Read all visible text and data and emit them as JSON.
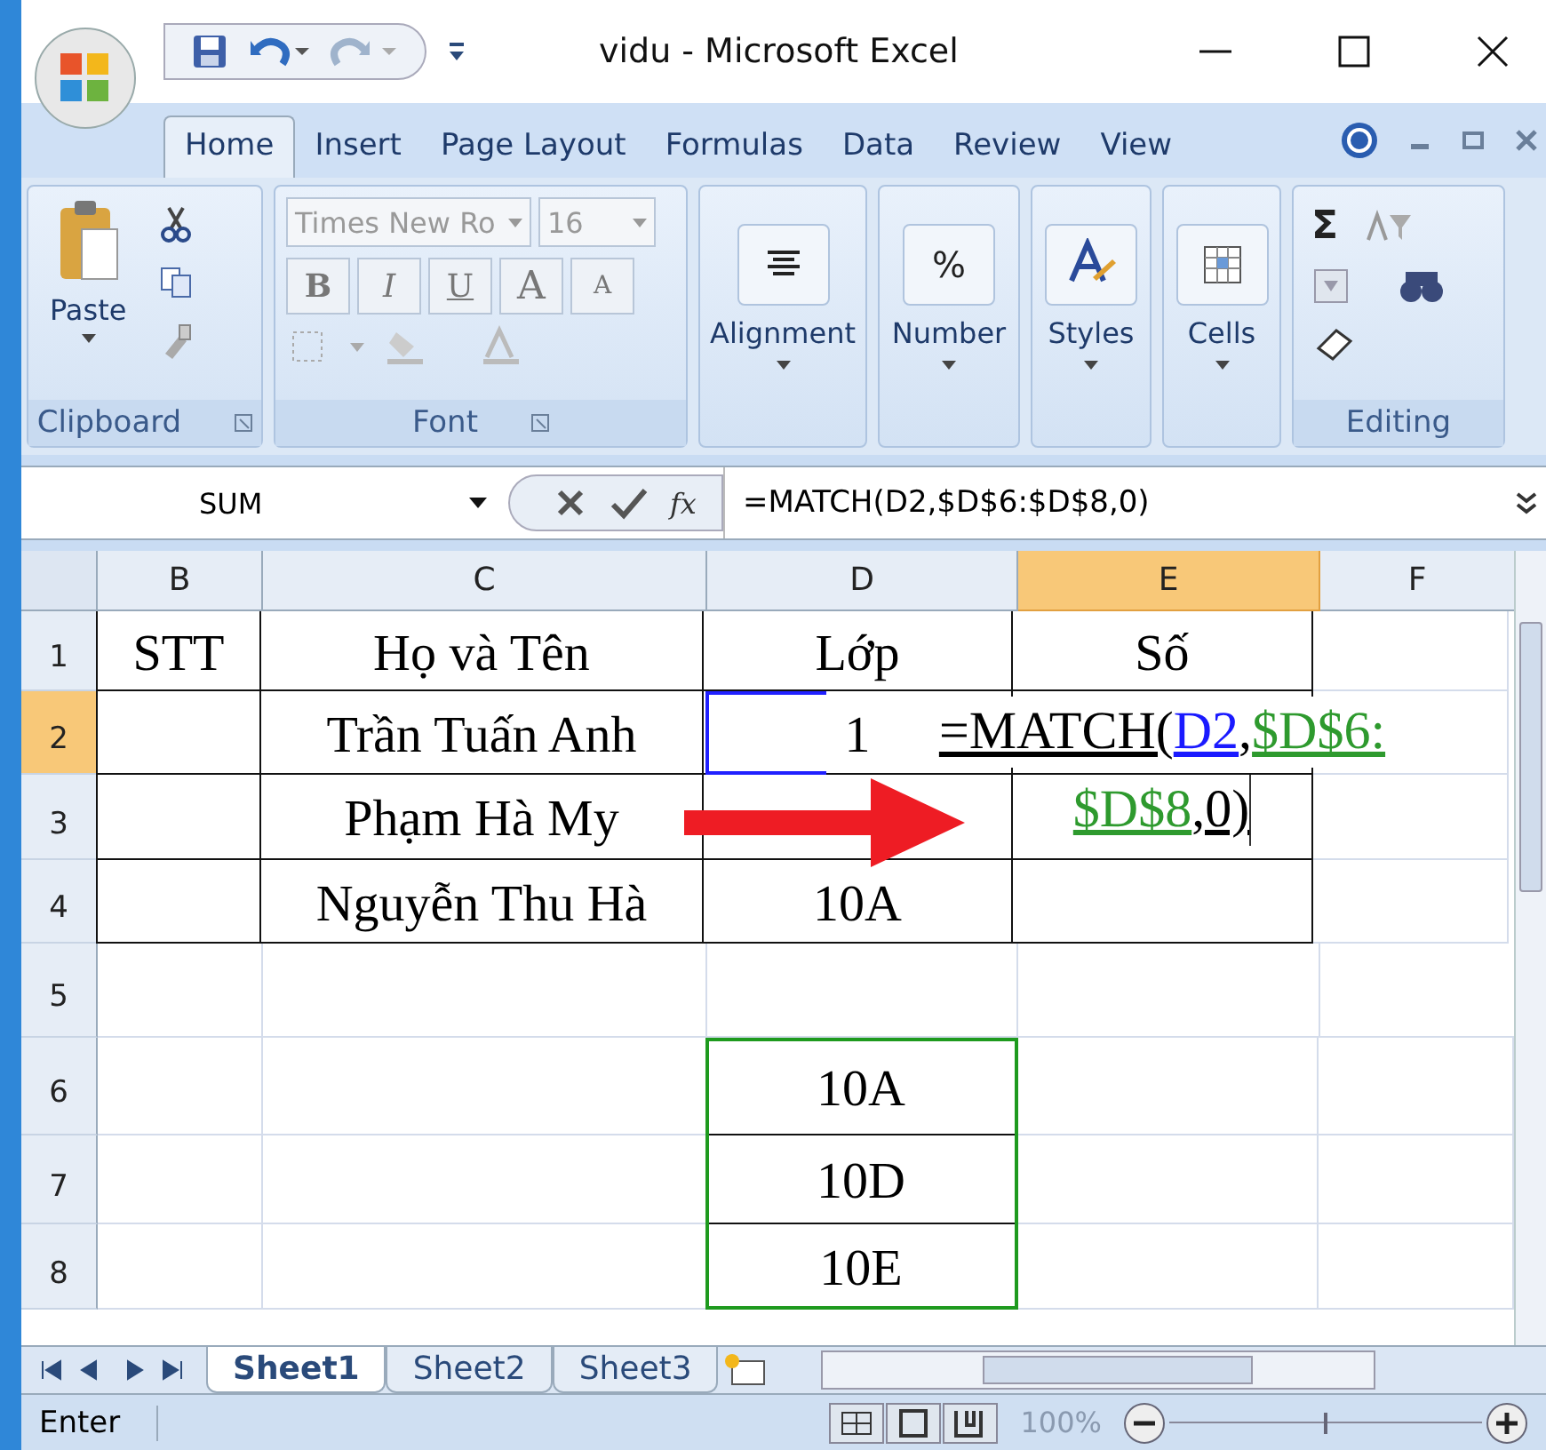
{
  "window": {
    "title": "vidu - Microsoft Excel"
  },
  "ribbon_tabs": [
    {
      "label": "Home",
      "selected": true
    },
    {
      "label": "Insert",
      "selected": false
    },
    {
      "label": "Page Layout",
      "selected": false
    },
    {
      "label": "Formulas",
      "selected": false
    },
    {
      "label": "Data",
      "selected": false
    },
    {
      "label": "Review",
      "selected": false
    },
    {
      "label": "View",
      "selected": false
    }
  ],
  "ribbon": {
    "clipboard": {
      "label": "Clipboard",
      "paste": "Paste"
    },
    "font": {
      "label": "Font",
      "font_name": "Times New Ro",
      "font_size": "16",
      "bold": "B",
      "italic": "I",
      "underline": "U",
      "grow": "A",
      "shrink": "A"
    },
    "groups": [
      {
        "label": "Alignment",
        "kind": "align"
      },
      {
        "label": "Number",
        "kind": "number",
        "glyph": "%"
      },
      {
        "label": "Styles",
        "kind": "styles"
      },
      {
        "label": "Cells",
        "kind": "cells"
      }
    ],
    "editing": {
      "label": "Editing",
      "autosum": "Σ"
    }
  },
  "formula_bar": {
    "name_box": "SUM",
    "function_button": "fx",
    "formula": "=MATCH(D2,$D$6:$D$8,0)"
  },
  "columns": [
    {
      "label": "B",
      "selected": false
    },
    {
      "label": "C",
      "selected": false
    },
    {
      "label": "D",
      "selected": false
    },
    {
      "label": "E",
      "selected": true
    },
    {
      "label": "F",
      "selected": false
    }
  ],
  "rows": [
    {
      "label": "1",
      "selected": false,
      "cells": [
        {
          "text": "STT",
          "border": true
        },
        {
          "text": "Họ và Tên",
          "border": true
        },
        {
          "text": "Lớp",
          "border": true
        },
        {
          "text": "Số",
          "border": true
        },
        {
          "border": false
        }
      ]
    },
    {
      "label": "2",
      "selected": true,
      "cells": [
        {
          "border": true
        },
        {
          "text": "Trần Tuấn Anh",
          "border": true
        },
        {
          "text": "1",
          "border": true
        },
        {
          "border": true
        },
        {
          "border": false
        }
      ]
    },
    {
      "label": "3",
      "selected": false,
      "cells": [
        {
          "border": true
        },
        {
          "text": "Phạm Hà My",
          "border": true
        },
        {
          "border": true
        },
        {
          "border": true
        },
        {
          "border": false
        }
      ]
    },
    {
      "label": "4",
      "selected": false,
      "cells": [
        {
          "border": true
        },
        {
          "text": "Nguyễn Thu Hà",
          "border": true
        },
        {
          "text": "10A",
          "border": true
        },
        {
          "border": true
        },
        {
          "border": false
        }
      ]
    },
    {
      "label": "5",
      "selected": false,
      "cells": [
        {
          "border": false
        },
        {
          "border": false
        },
        {
          "border": false
        },
        {
          "border": false
        },
        {
          "border": false
        }
      ]
    },
    {
      "label": "6",
      "selected": false,
      "cells": [
        {
          "border": false
        },
        {
          "border": false
        },
        {
          "text": "10A",
          "border": true
        },
        {
          "border": false
        },
        {
          "border": false
        }
      ]
    },
    {
      "label": "7",
      "selected": false,
      "cells": [
        {
          "border": false
        },
        {
          "border": false
        },
        {
          "text": "10D",
          "border": true
        },
        {
          "border": false
        },
        {
          "border": false
        }
      ]
    },
    {
      "label": "8",
      "selected": false,
      "cells": [
        {
          "border": false
        },
        {
          "border": false
        },
        {
          "text": "10E",
          "border": true
        },
        {
          "border": false
        },
        {
          "border": false
        }
      ]
    }
  ],
  "in_cell_edit": {
    "lines": [
      [
        {
          "text": "=MATCH(",
          "color": "#000000"
        },
        {
          "text": "D2",
          "color": "#1a1aff"
        },
        {
          "text": ",",
          "color": "#000000"
        },
        {
          "text": "$D$6:",
          "color": "#2e9a2e"
        }
      ],
      [
        {
          "text": "$D$8",
          "color": "#2e9a2e"
        },
        {
          "text": ",0)",
          "color": "#000000"
        }
      ]
    ]
  },
  "sheet_tabs": [
    {
      "label": "Sheet1",
      "selected": true
    },
    {
      "label": "Sheet2",
      "selected": false
    },
    {
      "label": "Sheet3",
      "selected": false
    }
  ],
  "status_bar": {
    "mode": "Enter",
    "zoom": "100%",
    "zoom_slider": {
      "level": 0.5
    }
  }
}
